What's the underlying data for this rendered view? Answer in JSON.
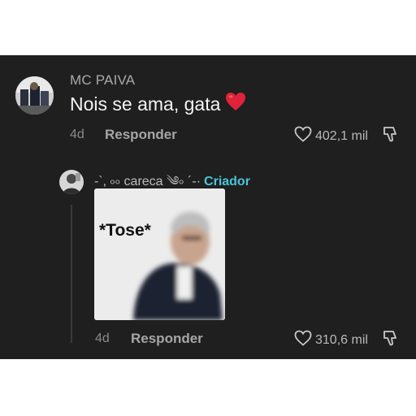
{
  "comment": {
    "username": "MC PAIVA",
    "text": "Nois se ama, gata",
    "emoji_name": "red-heart-emoji",
    "time": "4d",
    "reply_label": "Responder",
    "likes": "402,1 mil"
  },
  "reply": {
    "username": "-`, ৹৹ careca ༄৹ ´-·",
    "creator_badge": "Criador",
    "sticker_caption": "*Tose*",
    "time": "4d",
    "reply_label": "Responder",
    "likes": "310,6 mil"
  },
  "colors": {
    "panel_background": "#1f1f1f",
    "creator_badge": "#4bc4dc",
    "heart_emoji": "#e0233a"
  },
  "icons": [
    "heart-outline-icon",
    "dislike-icon"
  ]
}
